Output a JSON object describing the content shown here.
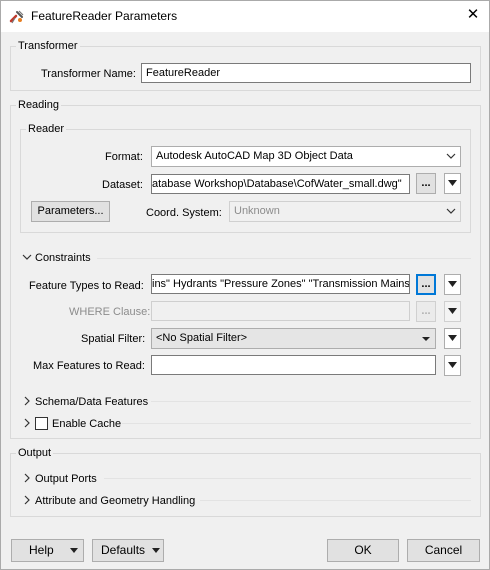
{
  "window": {
    "title": "FeatureReader Parameters",
    "icon": "transformer-icon",
    "close_icon": "close-icon"
  },
  "transformer": {
    "legend": "Transformer",
    "name_label": "Transformer Name:",
    "name_value": "FeatureReader"
  },
  "reading": {
    "legend": "Reading",
    "reader": {
      "legend": "Reader",
      "format_label": "Format:",
      "format_value": "Autodesk AutoCAD Map 3D Object Data",
      "dataset_label": "Dataset:",
      "dataset_value": "atabase Workshop\\Database\\CofWater_small.dwg\"",
      "browse_label": "...",
      "parameters_label": "Parameters...",
      "coord_label": "Coord. System:",
      "coord_value": "Unknown"
    },
    "constraints": {
      "title": "Constraints",
      "feature_types_label": "Feature Types to Read:",
      "feature_types_value": "ins\" Hydrants \"Pressure Zones\" \"Transmission Mains\"",
      "browse_label": "...",
      "where_label": "WHERE Clause:",
      "where_value": "",
      "spatial_label": "Spatial Filter:",
      "spatial_value": "<No Spatial Filter>",
      "max_label": "Max Features to Read:",
      "max_value": ""
    },
    "schema_title": "Schema/Data Features",
    "cache_label": "Enable Cache",
    "cache_checked": false
  },
  "output": {
    "legend": "Output",
    "ports_title": "Output Ports",
    "attr_title": "Attribute and Geometry Handling"
  },
  "buttons": {
    "help": "Help",
    "defaults": "Defaults",
    "ok": "OK",
    "cancel": "Cancel"
  },
  "colors": {
    "focus": "#0078d7",
    "background": "#f0f0f0"
  }
}
